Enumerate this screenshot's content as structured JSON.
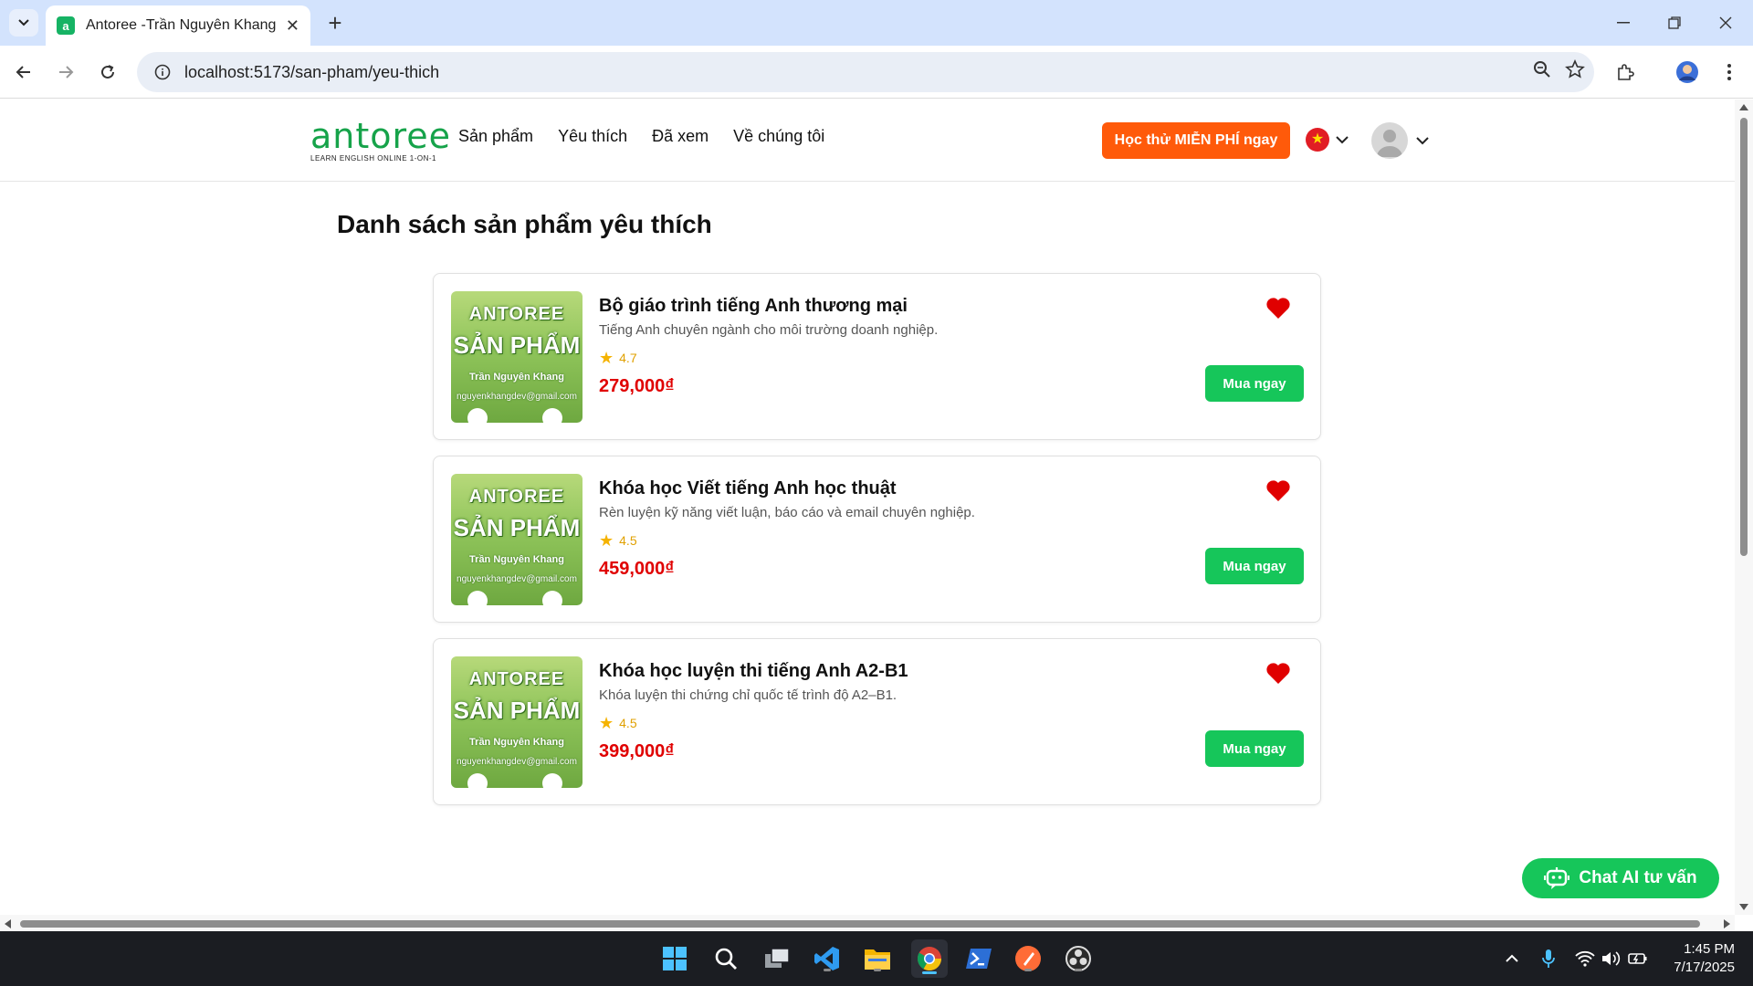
{
  "browser": {
    "tab_title": "Antoree -Trần Nguyên Khang",
    "url": "localhost:5173/san-pham/yeu-thich"
  },
  "site": {
    "logo": "antoree",
    "logo_tagline": "LEARN ENGLISH ONLINE 1-ON-1",
    "menu": [
      {
        "label": "Sản phẩm"
      },
      {
        "label": "Yêu thích"
      },
      {
        "label": "Đã xem"
      },
      {
        "label": "Về chúng tôi"
      }
    ],
    "cta_label": "Học thử MIỄN PHÍ ngay",
    "accent_color": "#ff5a0a",
    "brand_color": "#16a34a"
  },
  "page": {
    "title": "Danh sách sản phẩm yêu thích"
  },
  "thumbnail": {
    "line1": "ANTOREE",
    "line2": "SẢN PHẨM",
    "line3": "Trần Nguyên Khang",
    "line4": "nguyenkhangdev@gmail.com"
  },
  "products": [
    {
      "name": "Bộ giáo trình tiếng Anh thương mại",
      "description": "Tiếng Anh chuyên ngành cho môi trường doanh nghiệp.",
      "rating": "4.7",
      "price": "279,000₫",
      "buy_label": "Mua ngay"
    },
    {
      "name": "Khóa học Viết tiếng Anh học thuật",
      "description": "Rèn luyện kỹ năng viết luận, báo cáo và email chuyên nghiệp.",
      "rating": "4.5",
      "price": "459,000₫",
      "buy_label": "Mua ngay"
    },
    {
      "name": "Khóa học luyện thi tiếng Anh A2-B1",
      "description": "Khóa luyện thi chứng chỉ quốc tế trình độ A2–B1.",
      "rating": "4.5",
      "price": "399,000₫",
      "buy_label": "Mua ngay"
    }
  ],
  "chat": {
    "label": "Chat AI tư vấn"
  },
  "taskbar": {
    "time": "1:45 PM",
    "date": "7/17/2025"
  }
}
